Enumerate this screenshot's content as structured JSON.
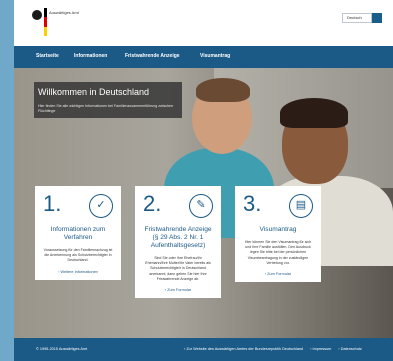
{
  "header": {
    "logo_text": "Auswärtiges Amt",
    "language": "Deutsch"
  },
  "nav": {
    "items": [
      "Startseite",
      "Informationen",
      "Fristwahrende Anzeige",
      "Visumantrag"
    ]
  },
  "hero": {
    "title": "Willkommen in Deutschland",
    "subtitle": "Hier finden Sie alle wichtigen Informationen bei Familienzusammenführung zwischen Flüchtlinge"
  },
  "cards": [
    {
      "number": "1.",
      "icon": "check-icon",
      "title": "Informationen zum Verfahren",
      "text": "Voraussetzung für den Familiennachzug ist die Anerkennung als Schutzberechtigter in Deutschland.",
      "link": "› Weitere Informationen"
    },
    {
      "number": "2.",
      "icon": "document-icon",
      "title": "Fristwahrende Anzeige (§ 29 Abs. 2 Nr. 1 Aufenthaltsgesetz)",
      "text": "Sind Sie oder Ihre Ehefrau/Ihr Ehemann/Ihre Mutter/Ihr Vater bereits als Schutzberechtigte/r in Deutschland anerkannt, dann geben Sie hier Ihre Fristwahrende Anzeige ab.",
      "link": "› Zum Formular"
    },
    {
      "number": "3.",
      "icon": "passport-icon",
      "title": "Visumantrag",
      "text": "Hier können Sie den Visumantrag für sich und Ihre Familie ausfüllen. Den Ausdruck legen Sie bitte bei der persönlichen Visumbeantragung in der zuständigen Vertretung vor.",
      "link": "› Zum Formular"
    }
  ],
  "footer": {
    "copyright": "© 1995-2015 Auswärtiges Amt",
    "links": [
      "› Zur Website des Auswärtigen Amtes der Bundesrepublik Deutschland",
      "› Impressum",
      "› Datenschutz"
    ]
  },
  "colors": {
    "brand_blue": "#1b5a87",
    "page_bg": "#6fa8c8"
  }
}
